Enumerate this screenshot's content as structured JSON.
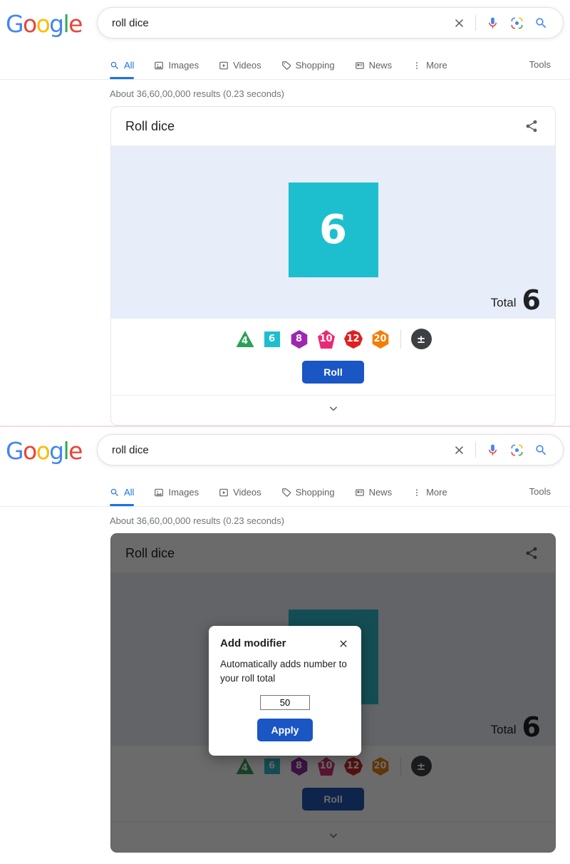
{
  "colors": {
    "accent_blue": "#1a73e8",
    "button_blue": "#1a56c4",
    "stage_bg": "#e8edfa",
    "die_cyan": "#1dbfcf",
    "d4_green": "#2aa155",
    "d6_cyan": "#1dbfcf",
    "d8_purple": "#9c27b0",
    "d10_pink": "#ea2a77",
    "d12_red": "#e02020",
    "d20_orange": "#f57c00",
    "modifier_gray": "#3c4043"
  },
  "screens": [
    {
      "id": "screen-normal",
      "header": {
        "logo": "Google",
        "search": {
          "value": "roll dice",
          "placeholder": "Search"
        },
        "icons": [
          "clear-icon",
          "voice-search-icon",
          "google-lens-icon",
          "search-icon"
        ],
        "tabs": [
          {
            "label": "All",
            "icon": "search-icon",
            "active": true
          },
          {
            "label": "Images",
            "icon": "image-icon",
            "active": false
          },
          {
            "label": "Videos",
            "icon": "video-icon",
            "active": false
          },
          {
            "label": "Shopping",
            "icon": "tag-icon",
            "active": false
          },
          {
            "label": "News",
            "icon": "news-icon",
            "active": false
          },
          {
            "label": "More",
            "icon": "more-vertical-icon",
            "active": false
          }
        ],
        "tools_label": "Tools",
        "results_count": "About 36,60,00,000 results (0.23 seconds)"
      },
      "widget": {
        "title": "Roll dice",
        "share_icon": "share-icon",
        "die_value": "6",
        "total_label": "Total",
        "total_value": "6",
        "dice_options": [
          {
            "sides": "4",
            "shape": "triangle",
            "color": "#2aa155"
          },
          {
            "sides": "6",
            "shape": "square",
            "color": "#1dbfcf"
          },
          {
            "sides": "8",
            "shape": "hexagon",
            "color": "#9c27b0"
          },
          {
            "sides": "10",
            "shape": "diamond",
            "color": "#ea2a77"
          },
          {
            "sides": "12",
            "shape": "dodecagon",
            "color": "#e02020"
          },
          {
            "sides": "20",
            "shape": "hexagon",
            "color": "#f57c00"
          }
        ],
        "modifier_symbol": "±",
        "roll_label": "Roll",
        "expand_icon": "chevron-down-icon"
      },
      "modal": null
    },
    {
      "id": "screen-modal",
      "header": {
        "logo": "Google",
        "search": {
          "value": "roll dice",
          "placeholder": "Search"
        },
        "icons": [
          "clear-icon",
          "voice-search-icon",
          "google-lens-icon",
          "search-icon"
        ],
        "tabs": [
          {
            "label": "All",
            "icon": "search-icon",
            "active": true
          },
          {
            "label": "Images",
            "icon": "image-icon",
            "active": false
          },
          {
            "label": "Videos",
            "icon": "video-icon",
            "active": false
          },
          {
            "label": "Shopping",
            "icon": "tag-icon",
            "active": false
          },
          {
            "label": "News",
            "icon": "news-icon",
            "active": false
          },
          {
            "label": "More",
            "icon": "more-vertical-icon",
            "active": false
          }
        ],
        "tools_label": "Tools",
        "results_count": "About 36,60,00,000 results (0.23 seconds)"
      },
      "widget": {
        "title": "Roll dice",
        "share_icon": "share-icon",
        "die_value": "6",
        "total_label": "Total",
        "total_value": "6",
        "dice_options": [
          {
            "sides": "4",
            "shape": "triangle",
            "color": "#2aa155"
          },
          {
            "sides": "6",
            "shape": "square",
            "color": "#1dbfcf"
          },
          {
            "sides": "8",
            "shape": "hexagon",
            "color": "#9c27b0"
          },
          {
            "sides": "10",
            "shape": "diamond",
            "color": "#ea2a77"
          },
          {
            "sides": "12",
            "shape": "dodecagon",
            "color": "#e02020"
          },
          {
            "sides": "20",
            "shape": "hexagon",
            "color": "#f57c00"
          }
        ],
        "modifier_symbol": "±",
        "roll_label": "Roll",
        "expand_icon": "chevron-down-icon"
      },
      "modal": {
        "title": "Add modifier",
        "close_icon": "close-icon",
        "description": "Automatically adds number to your roll total",
        "input_value": "50",
        "apply_label": "Apply"
      }
    }
  ]
}
